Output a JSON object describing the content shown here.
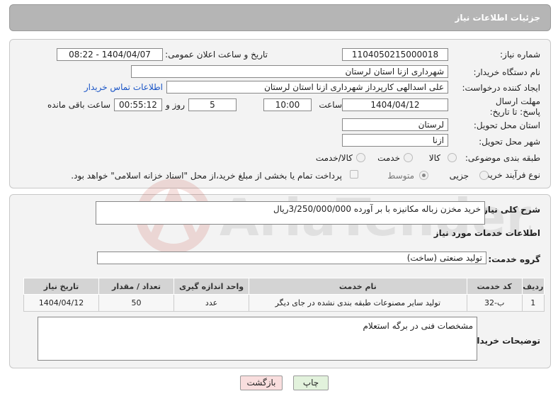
{
  "header": {
    "title": "جزئیات اطلاعات نیاز"
  },
  "form": {
    "need_number_label": "شماره نیاز:",
    "need_number": "1104050215000018",
    "announce_label": "تاریخ و ساعت اعلان عمومی:",
    "announce_value": "1404/04/07 - 08:22",
    "buyer_org_label": "نام دستگاه خریدار:",
    "buyer_org": "شهرداری ازنا استان لرستان",
    "creator_label": "ایجاد کننده درخواست:",
    "creator": "علی اسدالهی کارپرداز شهرداری ازنا استان لرستان",
    "contact_link": "اطلاعات تماس خریدار",
    "deadline_label": "مهلت ارسال پاسخ: تا تاریخ:",
    "deadline_date": "1404/04/12",
    "time_label": "ساعت",
    "deadline_time": "10:00",
    "days_value": "5",
    "days_label": "روز و",
    "remaining_time": "00:55:12",
    "remaining_label": "ساعت باقی مانده",
    "province_label": "استان محل تحویل:",
    "province": "لرستان",
    "city_label": "شهر محل تحویل:",
    "city": "ازنا",
    "category_label": "طبقه بندی موضوعی:",
    "category_options": [
      "کالا",
      "خدمت",
      "کالا/خدمت"
    ],
    "purchase_type_label": "نوع فرآیند خرید :",
    "purchase_options": [
      "جزیی",
      "متوسط"
    ],
    "payment_note": "پرداخت تمام یا بخشی از مبلغ خرید،از محل \"اسناد خزانه اسلامی\" خواهد بود."
  },
  "description": {
    "label": "شرح کلی نیاز:",
    "value": "خرید مخزن زباله مکانیزه با بر آورده 3/250/000/000ریال"
  },
  "services": {
    "section_title": "اطلاعات خدمات مورد نیاز",
    "group_label": "گروه خدمت:",
    "group_value": "تولید صنعتی (ساخت)",
    "columns": [
      "ردیف",
      "کد خدمت",
      "نام خدمت",
      "واحد اندازه گیری",
      "تعداد / مقدار",
      "تاریخ نیاز"
    ],
    "rows": [
      [
        "1",
        "ب-32",
        "تولید سایر مصنوعات طبقه بندی نشده در جای دیگر",
        "عدد",
        "50",
        "1404/04/12"
      ]
    ]
  },
  "buyer_notes": {
    "label": "توضیحات خریدار:",
    "value": "مشخصات فنی در برگه استعلام"
  },
  "buttons": {
    "print": "چاپ",
    "back": "بازگشت"
  },
  "watermark": {
    "text": "AriaTender.neT"
  },
  "colors": {
    "header_bg": "#b5b5b5",
    "link": "#1a55c6",
    "back_button_bg": "#f9dede",
    "print_button_bg": "#e2f2dc"
  }
}
